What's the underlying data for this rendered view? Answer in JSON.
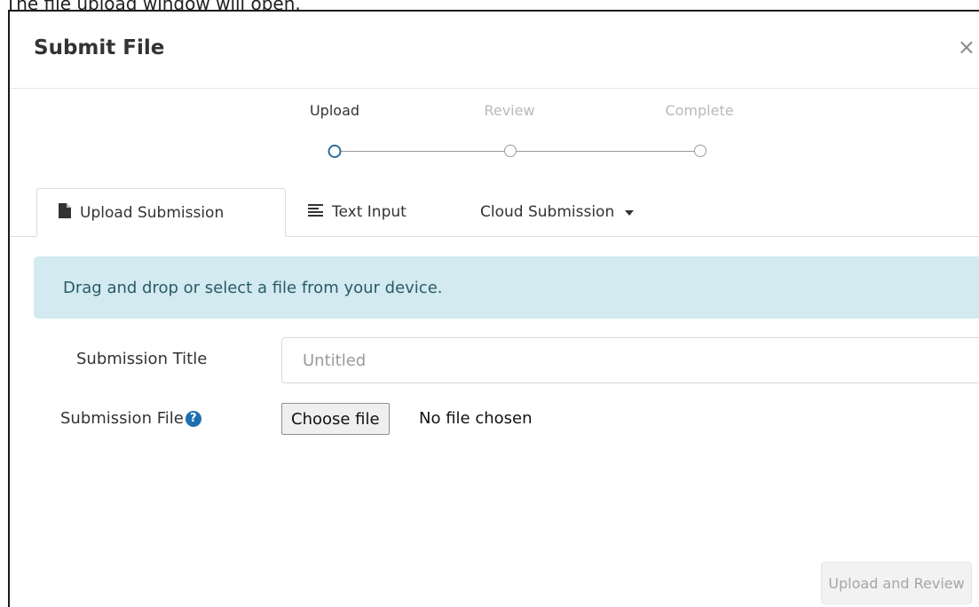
{
  "caption": "The file upload window will open.",
  "modal": {
    "title": "Submit File",
    "close_icon": "×"
  },
  "stepper": {
    "steps": [
      {
        "label": "Upload",
        "state": "active"
      },
      {
        "label": "Review",
        "state": "inactive"
      },
      {
        "label": "Complete",
        "state": "inactive"
      }
    ]
  },
  "tabs": [
    {
      "label": "Upload Submission",
      "icon": "file-icon",
      "active": true
    },
    {
      "label": "Text Input",
      "icon": "align-left-icon",
      "active": false
    },
    {
      "label": "Cloud Submission",
      "icon": "caret-down-icon",
      "active": false
    }
  ],
  "info": {
    "message": "Drag and drop or select a file from your device."
  },
  "form": {
    "title_label": "Submission Title",
    "title_placeholder": "Untitled",
    "file_label": "Submission File",
    "help_icon": "question-circle-icon",
    "choose_file_label": "Choose file",
    "file_status": "No file chosen"
  },
  "footer": {
    "submit_label": "Upload and Review"
  },
  "colors": {
    "info_bg": "#d2eaf0",
    "info_text": "#2a5a68",
    "active_step": "#2d6e9e",
    "help_icon": "#1f6fb0"
  }
}
